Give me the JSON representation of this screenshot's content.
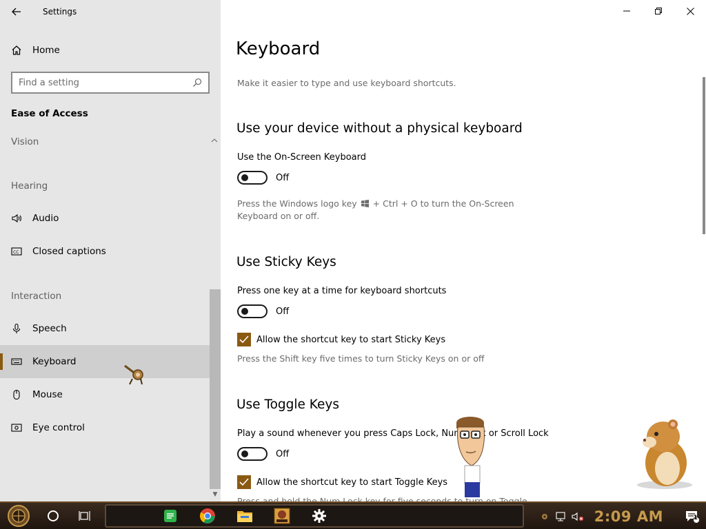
{
  "app": {
    "title": "Settings"
  },
  "sidebar": {
    "home_label": "Home",
    "search_placeholder": "Find a setting",
    "section_title": "Ease of Access",
    "groups": [
      {
        "header": "Vision"
      },
      {
        "header": "Hearing",
        "items": [
          {
            "label": "Audio",
            "icon": "speaker-icon"
          },
          {
            "label": "Closed captions",
            "icon": "closed-captions-icon"
          }
        ]
      },
      {
        "header": "Interaction",
        "items": [
          {
            "label": "Speech",
            "icon": "microphone-icon"
          },
          {
            "label": "Keyboard",
            "icon": "keyboard-icon",
            "selected": true
          },
          {
            "label": "Mouse",
            "icon": "mouse-icon"
          },
          {
            "label": "Eye control",
            "icon": "eye-control-icon"
          }
        ]
      }
    ]
  },
  "main": {
    "title": "Keyboard",
    "subtitle": "Make it easier to type and use keyboard shortcuts.",
    "sections": [
      {
        "heading": "Use your device without a physical keyboard",
        "label": "Use the On-Screen Keyboard",
        "toggle_state": "Off",
        "desc_part1": "Press the Windows logo key",
        "desc_part2": "+ Ctrl + O to turn the On-Screen",
        "desc_part3": "Keyboard on or off."
      },
      {
        "heading": "Use Sticky Keys",
        "label": "Press one key at a time for keyboard shortcuts",
        "toggle_state": "Off",
        "checkbox_label": "Allow the shortcut key to start Sticky Keys",
        "checkbox_checked": true,
        "desc": "Press the Shift key five times to turn Sticky Keys on or off"
      },
      {
        "heading": "Use Toggle Keys",
        "label": "Play a sound whenever you press Caps Lock, Num Lock or Scroll Lock",
        "toggle_state": "Off",
        "checkbox_label": "Allow the shortcut key to start Toggle Keys",
        "checkbox_checked": true,
        "desc": "Press and hold the Num Lock key for five seconds to turn on Toggle"
      }
    ]
  },
  "taskbar": {
    "time": "2:09 AM",
    "notification_count": "1",
    "apps": [
      "notes-icon",
      "chrome-icon",
      "file-explorer-icon",
      "game-app-icon",
      "settings-gear-icon"
    ],
    "accent": "#c69a4c"
  },
  "colors": {
    "accent": "#8a5a12",
    "sidebar_bg": "#e6e6e6",
    "selected_bg": "#cfcfcf"
  }
}
